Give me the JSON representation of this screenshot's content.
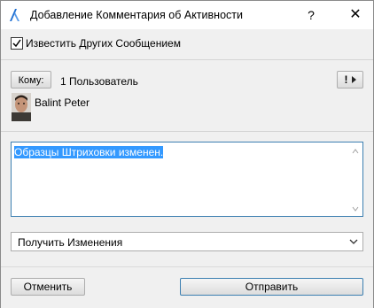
{
  "window": {
    "title": "Добавление Комментария об Активности",
    "help_label": "?",
    "close_label": "✕"
  },
  "notify": {
    "label": "Известить Других Сообщением",
    "checked": true
  },
  "recipients": {
    "to_button": "Кому:",
    "count_text": "1 Пользователь",
    "flag_label": "!",
    "user_name": "Balint Peter"
  },
  "comment": {
    "text": "Образцы Штриховки изменен."
  },
  "action_select": {
    "selected": "Получить Изменения"
  },
  "footer": {
    "cancel_label": "Отменить",
    "send_label": "Отправить"
  },
  "colors": {
    "focus_border": "#3c7fb1",
    "selection": "#3399ff"
  }
}
